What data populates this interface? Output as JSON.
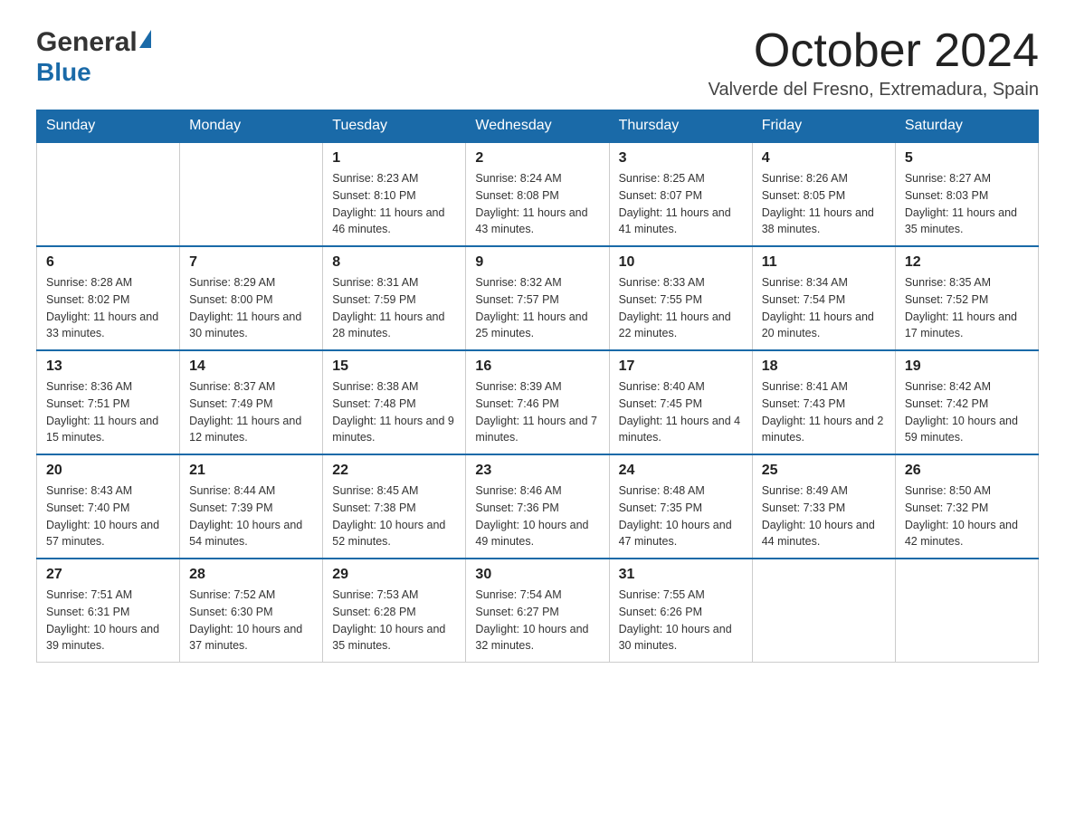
{
  "header": {
    "logo_general": "General",
    "logo_blue": "Blue",
    "month_title": "October 2024",
    "location": "Valverde del Fresno, Extremadura, Spain"
  },
  "days_of_week": [
    "Sunday",
    "Monday",
    "Tuesday",
    "Wednesday",
    "Thursday",
    "Friday",
    "Saturday"
  ],
  "weeks": [
    [
      {
        "day": "",
        "info": ""
      },
      {
        "day": "",
        "info": ""
      },
      {
        "day": "1",
        "info": "Sunrise: 8:23 AM\nSunset: 8:10 PM\nDaylight: 11 hours\nand 46 minutes."
      },
      {
        "day": "2",
        "info": "Sunrise: 8:24 AM\nSunset: 8:08 PM\nDaylight: 11 hours\nand 43 minutes."
      },
      {
        "day": "3",
        "info": "Sunrise: 8:25 AM\nSunset: 8:07 PM\nDaylight: 11 hours\nand 41 minutes."
      },
      {
        "day": "4",
        "info": "Sunrise: 8:26 AM\nSunset: 8:05 PM\nDaylight: 11 hours\nand 38 minutes."
      },
      {
        "day": "5",
        "info": "Sunrise: 8:27 AM\nSunset: 8:03 PM\nDaylight: 11 hours\nand 35 minutes."
      }
    ],
    [
      {
        "day": "6",
        "info": "Sunrise: 8:28 AM\nSunset: 8:02 PM\nDaylight: 11 hours\nand 33 minutes."
      },
      {
        "day": "7",
        "info": "Sunrise: 8:29 AM\nSunset: 8:00 PM\nDaylight: 11 hours\nand 30 minutes."
      },
      {
        "day": "8",
        "info": "Sunrise: 8:31 AM\nSunset: 7:59 PM\nDaylight: 11 hours\nand 28 minutes."
      },
      {
        "day": "9",
        "info": "Sunrise: 8:32 AM\nSunset: 7:57 PM\nDaylight: 11 hours\nand 25 minutes."
      },
      {
        "day": "10",
        "info": "Sunrise: 8:33 AM\nSunset: 7:55 PM\nDaylight: 11 hours\nand 22 minutes."
      },
      {
        "day": "11",
        "info": "Sunrise: 8:34 AM\nSunset: 7:54 PM\nDaylight: 11 hours\nand 20 minutes."
      },
      {
        "day": "12",
        "info": "Sunrise: 8:35 AM\nSunset: 7:52 PM\nDaylight: 11 hours\nand 17 minutes."
      }
    ],
    [
      {
        "day": "13",
        "info": "Sunrise: 8:36 AM\nSunset: 7:51 PM\nDaylight: 11 hours\nand 15 minutes."
      },
      {
        "day": "14",
        "info": "Sunrise: 8:37 AM\nSunset: 7:49 PM\nDaylight: 11 hours\nand 12 minutes."
      },
      {
        "day": "15",
        "info": "Sunrise: 8:38 AM\nSunset: 7:48 PM\nDaylight: 11 hours\nand 9 minutes."
      },
      {
        "day": "16",
        "info": "Sunrise: 8:39 AM\nSunset: 7:46 PM\nDaylight: 11 hours\nand 7 minutes."
      },
      {
        "day": "17",
        "info": "Sunrise: 8:40 AM\nSunset: 7:45 PM\nDaylight: 11 hours\nand 4 minutes."
      },
      {
        "day": "18",
        "info": "Sunrise: 8:41 AM\nSunset: 7:43 PM\nDaylight: 11 hours\nand 2 minutes."
      },
      {
        "day": "19",
        "info": "Sunrise: 8:42 AM\nSunset: 7:42 PM\nDaylight: 10 hours\nand 59 minutes."
      }
    ],
    [
      {
        "day": "20",
        "info": "Sunrise: 8:43 AM\nSunset: 7:40 PM\nDaylight: 10 hours\nand 57 minutes."
      },
      {
        "day": "21",
        "info": "Sunrise: 8:44 AM\nSunset: 7:39 PM\nDaylight: 10 hours\nand 54 minutes."
      },
      {
        "day": "22",
        "info": "Sunrise: 8:45 AM\nSunset: 7:38 PM\nDaylight: 10 hours\nand 52 minutes."
      },
      {
        "day": "23",
        "info": "Sunrise: 8:46 AM\nSunset: 7:36 PM\nDaylight: 10 hours\nand 49 minutes."
      },
      {
        "day": "24",
        "info": "Sunrise: 8:48 AM\nSunset: 7:35 PM\nDaylight: 10 hours\nand 47 minutes."
      },
      {
        "day": "25",
        "info": "Sunrise: 8:49 AM\nSunset: 7:33 PM\nDaylight: 10 hours\nand 44 minutes."
      },
      {
        "day": "26",
        "info": "Sunrise: 8:50 AM\nSunset: 7:32 PM\nDaylight: 10 hours\nand 42 minutes."
      }
    ],
    [
      {
        "day": "27",
        "info": "Sunrise: 7:51 AM\nSunset: 6:31 PM\nDaylight: 10 hours\nand 39 minutes."
      },
      {
        "day": "28",
        "info": "Sunrise: 7:52 AM\nSunset: 6:30 PM\nDaylight: 10 hours\nand 37 minutes."
      },
      {
        "day": "29",
        "info": "Sunrise: 7:53 AM\nSunset: 6:28 PM\nDaylight: 10 hours\nand 35 minutes."
      },
      {
        "day": "30",
        "info": "Sunrise: 7:54 AM\nSunset: 6:27 PM\nDaylight: 10 hours\nand 32 minutes."
      },
      {
        "day": "31",
        "info": "Sunrise: 7:55 AM\nSunset: 6:26 PM\nDaylight: 10 hours\nand 30 minutes."
      },
      {
        "day": "",
        "info": ""
      },
      {
        "day": "",
        "info": ""
      }
    ]
  ]
}
